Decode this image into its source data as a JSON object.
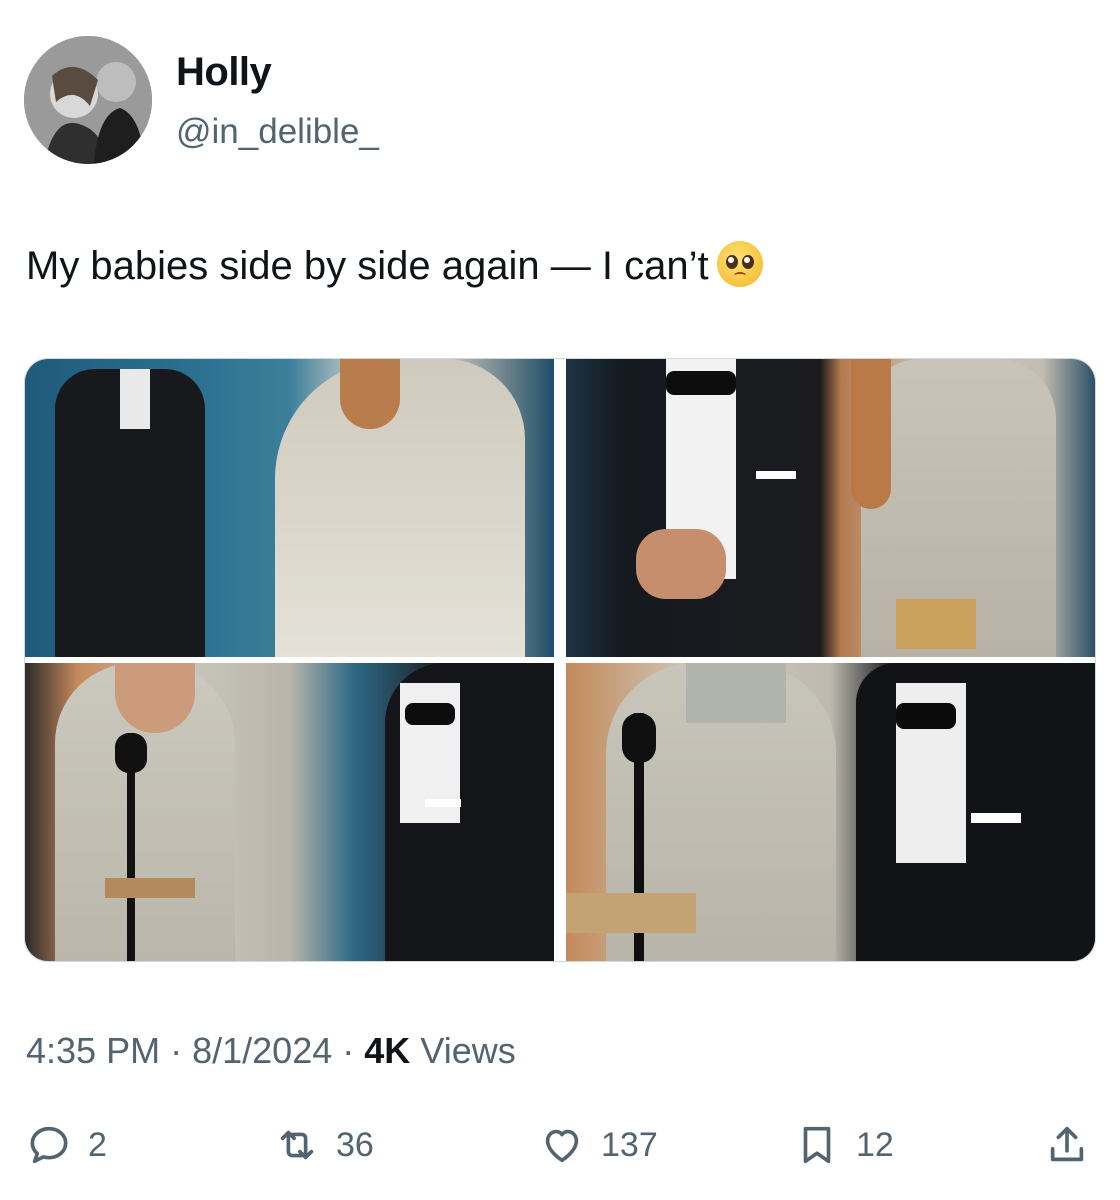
{
  "author": {
    "display_name": "Holly",
    "handle": "@in_delible_"
  },
  "tweet": {
    "text": "My babies side by side again — I can’t",
    "emoji_icon": "pleading-face-emoji"
  },
  "media": {
    "photo_count": 4
  },
  "meta": {
    "time": "4:35 PM",
    "date": "8/1/2024",
    "views_count": "4K",
    "views_label": "Views"
  },
  "actions": {
    "reply_count": "2",
    "retweet_count": "36",
    "like_count": "137",
    "bookmark_count": "12"
  },
  "colors": {
    "text": "#0f1419",
    "secondary": "#536471",
    "border": "#cfd9de"
  }
}
